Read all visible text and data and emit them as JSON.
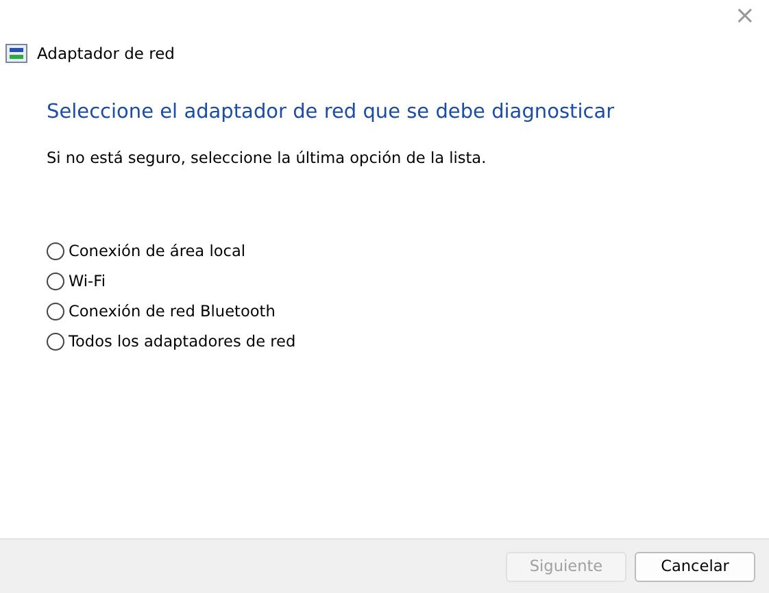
{
  "window": {
    "title": "Adaptador de red",
    "close": "×"
  },
  "heading": "Seleccione el adaptador de red que se debe diagnosticar",
  "instruction": "Si no está seguro, seleccione la última opción de la lista.",
  "options": [
    {
      "label": "Conexión de área local",
      "selected": false
    },
    {
      "label": "Wi-Fi",
      "selected": false
    },
    {
      "label": "Conexión de red Bluetooth",
      "selected": false
    },
    {
      "label": "Todos los adaptadores de red",
      "selected": false
    }
  ],
  "buttons": [
    {
      "label": "Siguiente",
      "disabled": true
    },
    {
      "label": "Cancelar",
      "disabled": false
    }
  ]
}
